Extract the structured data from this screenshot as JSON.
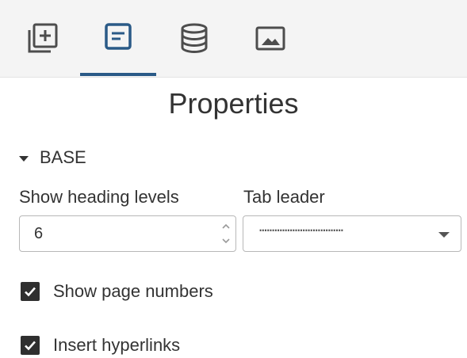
{
  "panel": {
    "title": "Properties",
    "tabs": [
      {
        "icon": "add-layer-icon",
        "active": false
      },
      {
        "icon": "properties-form-icon",
        "active": true
      },
      {
        "icon": "database-icon",
        "active": false
      },
      {
        "icon": "image-icon",
        "active": false
      }
    ],
    "accent_color": "#2a5a87",
    "section": {
      "label": "BASE",
      "heading_levels_label": "Show heading levels",
      "heading_levels_value": "6",
      "tab_leader_label": "Tab leader",
      "tab_leader_value": "……………………………",
      "show_page_numbers_label": "Show page numbers",
      "show_page_numbers_checked": true,
      "insert_hyperlinks_label": "Insert hyperlinks",
      "insert_hyperlinks_checked": true
    }
  }
}
